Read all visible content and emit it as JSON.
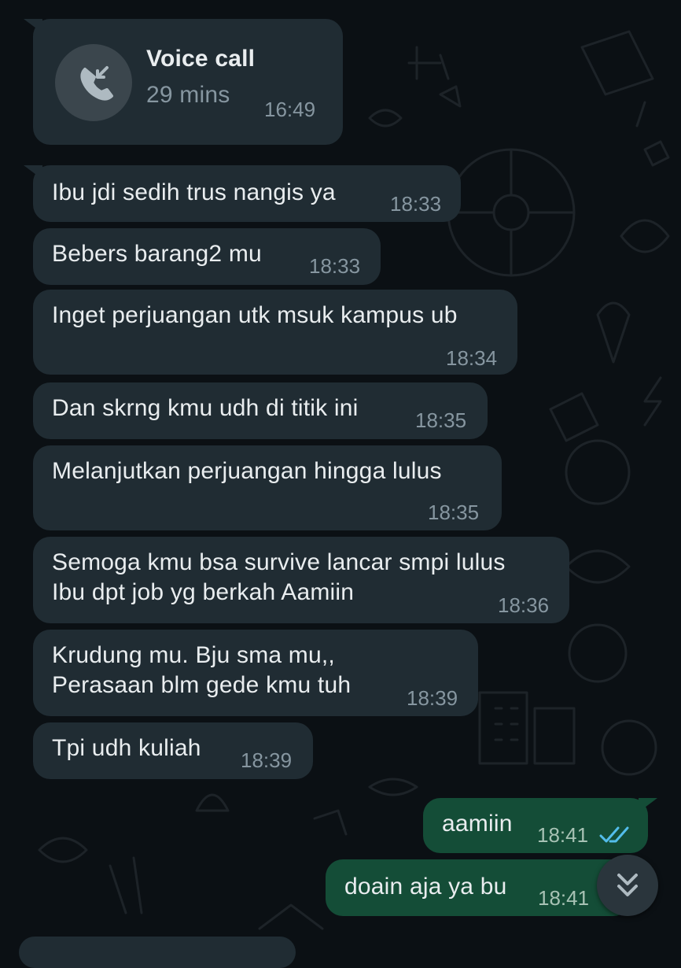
{
  "call": {
    "icon": "incoming-call-icon",
    "title": "Voice call",
    "duration": "29 mins",
    "time": "16:49"
  },
  "messages": [
    {
      "lines": [
        "Ibu jdi sedih trus nangis ya"
      ],
      "time": "18:33"
    },
    {
      "lines": [
        "Bebers barang2 mu"
      ],
      "time": "18:33"
    },
    {
      "lines": [
        "Inget perjuangan utk msuk kampus ub"
      ],
      "time": "18:34"
    },
    {
      "lines": [
        "Dan skrng kmu udh di titik ini"
      ],
      "time": "18:35"
    },
    {
      "lines": [
        "Melanjutkan perjuangan hingga lulus"
      ],
      "time": "18:35"
    },
    {
      "lines": [
        "Semoga kmu bsa survive lancar smpi lulus",
        "Ibu dpt job yg berkah Aamiin"
      ],
      "time": "18:36"
    },
    {
      "lines": [
        "Krudung mu. Bju sma mu,,",
        "Perasaan blm gede kmu tuh"
      ],
      "time": "18:39"
    },
    {
      "lines": [
        "Tpi udh kuliah"
      ],
      "time": "18:39"
    },
    {
      "lines": [
        "aamiin"
      ],
      "time": "18:41",
      "status": "read-double-check-icon"
    },
    {
      "lines": [
        "doain aja ya bu"
      ],
      "time": "18:41"
    }
  ],
  "scroll_button": {
    "icon": "double-chevron-down-icon"
  },
  "colors": {
    "background": "#0b1014",
    "incoming_bubble": "#202c33",
    "outgoing_bubble": "#144d37",
    "read_ticks": "#53bdeb"
  }
}
